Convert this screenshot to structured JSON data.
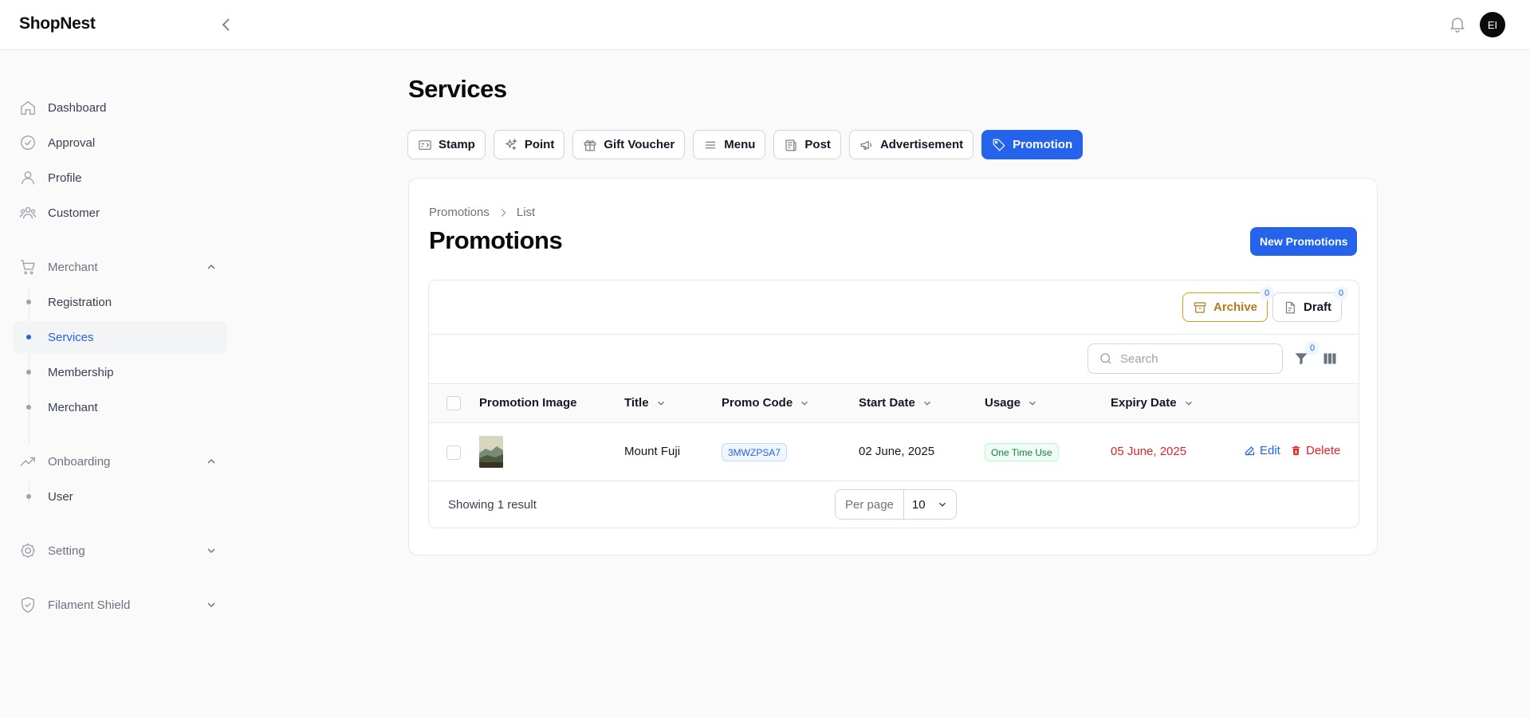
{
  "app": {
    "brand": "ShopNest",
    "avatar_initials": "EI"
  },
  "sidebar": {
    "items": [
      {
        "label": "Dashboard",
        "icon": "home-icon"
      },
      {
        "label": "Approval",
        "icon": "check-circle-icon"
      },
      {
        "label": "Profile",
        "icon": "user-icon"
      },
      {
        "label": "Customer",
        "icon": "users-icon"
      }
    ],
    "groups": {
      "merchant": {
        "label": "Merchant",
        "icon": "cart-icon",
        "expanded": true,
        "items": [
          "Registration",
          "Services",
          "Membership",
          "Merchant"
        ],
        "active": "Services"
      },
      "onboarding": {
        "label": "Onboarding",
        "icon": "trending-up-icon",
        "expanded": true,
        "items": [
          "User"
        ]
      },
      "setting": {
        "label": "Setting",
        "icon": "cog-icon",
        "expanded": false
      },
      "filament_shield": {
        "label": "Filament Shield",
        "icon": "shield-icon",
        "expanded": false
      }
    }
  },
  "main": {
    "title": "Services",
    "tabs": [
      {
        "label": "Stamp",
        "icon": "ticket-icon"
      },
      {
        "label": "Point",
        "icon": "sparkles-icon"
      },
      {
        "label": "Gift Voucher",
        "icon": "gift-icon"
      },
      {
        "label": "Menu",
        "icon": "menu-icon"
      },
      {
        "label": "Post",
        "icon": "newspaper-icon"
      },
      {
        "label": "Advertisement",
        "icon": "megaphone-icon"
      },
      {
        "label": "Promotion",
        "icon": "tag-icon",
        "active": true
      }
    ]
  },
  "card": {
    "breadcrumb": [
      "Promotions",
      "List"
    ],
    "title": "Promotions",
    "new_button": "New Promotions",
    "archive": {
      "label": "Archive",
      "count": "0"
    },
    "draft": {
      "label": "Draft",
      "count": "0"
    },
    "search_placeholder": "Search",
    "filter_count": "0",
    "columns": [
      "Promotion Image",
      "Title",
      "Promo Code",
      "Start Date",
      "Usage",
      "Expiry Date"
    ],
    "rows": [
      {
        "title": "Mount Fuji",
        "promo_code": "3MWZPSA7",
        "start_date": "02 June, 2025",
        "usage": "One Time Use",
        "expiry_date": "05 June, 2025",
        "edit": "Edit",
        "delete": "Delete"
      }
    ],
    "footer": {
      "showing": "Showing 1 result",
      "per_page_label": "Per page",
      "per_page_value": "10"
    }
  },
  "colors": {
    "primary": "#2563eb",
    "danger": "#dc2626",
    "success": "#15803d",
    "warning": "#b7791f"
  }
}
